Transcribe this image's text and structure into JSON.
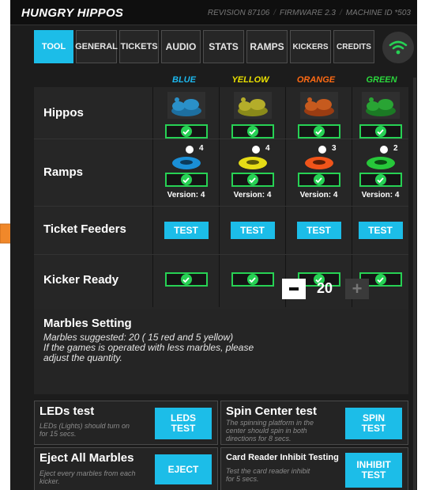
{
  "header": {
    "title": "HUNGRY HIPPOS",
    "revision": "REVISION 87106",
    "firmware": "FIRMWARE 2.3",
    "machine_id": "MACHINE ID *503"
  },
  "tabs": [
    {
      "label": "TOOL",
      "active": true
    },
    {
      "label": "GENERAL",
      "active": false
    },
    {
      "label": "TICKETS",
      "active": false
    },
    {
      "label": "AUDIO",
      "active": false
    },
    {
      "label": "STATS",
      "active": false
    },
    {
      "label": "RAMPS",
      "active": false
    },
    {
      "label": "KICKERS",
      "active": false
    },
    {
      "label": "CREDITS",
      "active": false
    }
  ],
  "wifi_icon": "wifi-icon",
  "columns": [
    {
      "label": "BLUE",
      "color": "#1cb8ee"
    },
    {
      "label": "YELLOW",
      "color": "#e9e000"
    },
    {
      "label": "ORANGE",
      "color": "#ff6a13"
    },
    {
      "label": "GREEN",
      "color": "#2bd83d"
    }
  ],
  "rows": {
    "hippos": {
      "label": "Hippos"
    },
    "ramps": {
      "label": "Ramps",
      "marble_counts": [
        "4",
        "4",
        "3",
        "2"
      ],
      "versions": [
        "Version: 4",
        "Version: 4",
        "Version: 4",
        "Version: 4"
      ]
    },
    "ticket_feeders": {
      "label": "Ticket Feeders",
      "button": "TEST"
    },
    "kicker_ready": {
      "label": "Kicker Ready"
    }
  },
  "marbles": {
    "title": "Marbles Setting",
    "desc_line1": "Marbles suggested: 20 ( 15 red and 5 yellow)",
    "desc_line2": "If the games is operated with less marbles, please",
    "desc_line3": "adjust the quantity.",
    "quantity": "20"
  },
  "cards": {
    "leds": {
      "title": "LEDs test",
      "desc1": "LEDs (Lights) should turn on",
      "desc2": "for 15 secs.",
      "btn1": "LEDS",
      "btn2": "TEST"
    },
    "spin": {
      "title": "Spin Center test",
      "desc1": "The spinning platform in the",
      "desc2": "center should spin in both",
      "desc3": "directions for 8 secs.",
      "btn1": "SPIN",
      "btn2": "TEST"
    },
    "eject": {
      "title": "Eject All Marbles",
      "desc1": "Eject every marbles from each",
      "desc2": "kicker.",
      "btn": "EJECT"
    },
    "card_reader": {
      "title": "Card Reader Inhibit Testing",
      "desc1": "Test the card reader inhibit",
      "desc2": "for 5 secs.",
      "btn1": "INHIBIT",
      "btn2": "TEST"
    }
  },
  "colors": {
    "accent": "#1cbde8",
    "status_ok": "#27d154",
    "pointer_arrow": "#f0882a"
  }
}
